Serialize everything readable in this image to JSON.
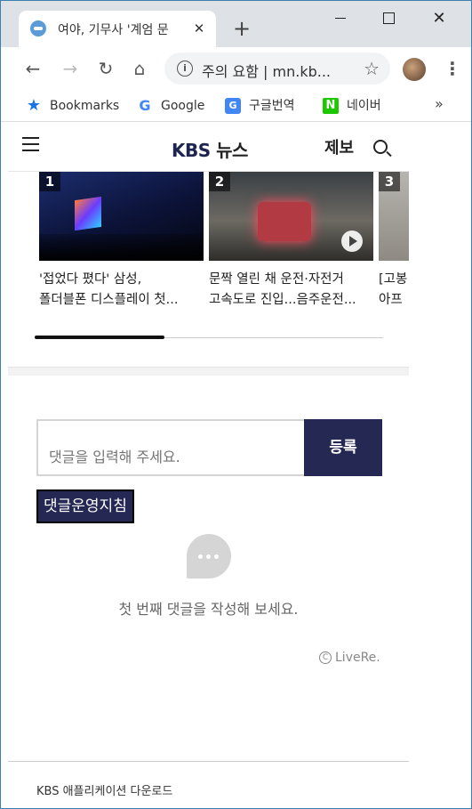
{
  "browser": {
    "tab_title": "여야, 기무사 '계엄 문",
    "tab_close": "✕",
    "new_tab": "+",
    "win_close": "✕",
    "omnibox_text": "주의 요함 | mn.kb...",
    "info_icon": "i",
    "star": "☆",
    "menu": "⋮",
    "nav_back": "←",
    "nav_forward": "→",
    "nav_reload": "↻",
    "nav_home": "⌂",
    "bookmarks": [
      {
        "label": "Bookmarks",
        "icon": "★"
      },
      {
        "label": "Google",
        "icon": "G"
      },
      {
        "label": "구글번역",
        "icon": "G"
      },
      {
        "label": "네이버",
        "icon": "N"
      }
    ],
    "bookmarks_more": "»"
  },
  "header": {
    "logo_main": "KBS",
    "logo_sub": "뉴스",
    "report": "제보"
  },
  "cards": [
    {
      "rank": "1",
      "title_line1": "'접었다 폈다' 삼성,",
      "title_line2": "폴더블폰 디스플레이 첫..."
    },
    {
      "rank": "2",
      "title_line1": "문짝 열린 채 운전·자전거",
      "title_line2": "고속도로 진입...음주운전..."
    },
    {
      "rank": "3",
      "title_line1": "[고봉",
      "title_line2": "아프"
    }
  ],
  "comments": {
    "placeholder": "댓글을 입력해 주세요.",
    "submit": "등록",
    "policy": "댓글운영지침",
    "empty": "첫 번째 댓글을 작성해 보세요.",
    "provider": "LiveRe.",
    "provider_mark": "C"
  },
  "footer": {
    "text": "KBS 애플리케이션 다운로드"
  },
  "colors": {
    "brand_navy": "#262854",
    "chrome_bg": "#dee1e6"
  }
}
